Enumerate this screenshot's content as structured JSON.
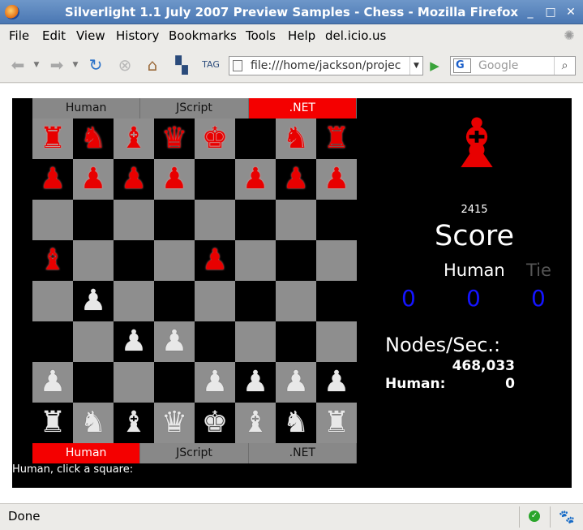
{
  "window": {
    "title": "Silverlight 1.1 July 2007 Preview Samples - Chess - Mozilla Firefox"
  },
  "menu": [
    "File",
    "Edit",
    "View",
    "History",
    "Bookmarks",
    "Tools",
    "Help",
    "del.icio.us"
  ],
  "nav": {
    "url": "file:///home/jackson/projec",
    "search_placeholder": "Google",
    "search_engine": "G"
  },
  "game": {
    "top_tabs": [
      {
        "label": "Human",
        "active": false
      },
      {
        "label": "JScript",
        "active": false
      },
      {
        "label": ".NET",
        "active": true
      }
    ],
    "bottom_tabs": [
      {
        "label": "Human",
        "active": true
      },
      {
        "label": "JScript",
        "active": false
      },
      {
        "label": ".NET",
        "active": false
      }
    ],
    "board": [
      [
        "r:♜",
        "r:♞",
        "r:♝",
        "r:♛",
        "r:♚",
        "",
        "r:♞",
        "r:♜"
      ],
      [
        "r:♟",
        "r:♟",
        "r:♟",
        "r:♟",
        "",
        "r:♟",
        "r:♟",
        "r:♟"
      ],
      [
        "",
        "",
        "",
        "",
        "",
        "",
        "",
        ""
      ],
      [
        "r:♝",
        "",
        "",
        "",
        "r:♟",
        "",
        "",
        ""
      ],
      [
        "",
        "w:♟",
        "",
        "",
        "",
        "",
        "",
        ""
      ],
      [
        "",
        "",
        "w:♟",
        "w:♟",
        "",
        "",
        "",
        ""
      ],
      [
        "w:♟",
        "",
        "",
        "",
        "w:♟",
        "w:♟",
        "w:♟",
        "w:♟"
      ],
      [
        "w:♜",
        "w:♞",
        "w:♝",
        "w:♛",
        "w:♚",
        "w:♝",
        "w:♞",
        "w:♜"
      ]
    ],
    "prompt": "Human, click a square:",
    "year_value": "2415",
    "score_title": "Score",
    "score_headers": [
      {
        "label": "Human",
        "color": "#ffffff"
      },
      {
        "label": "Tie",
        "color": "#555555"
      }
    ],
    "score_values": [
      "0",
      "0",
      "0"
    ],
    "nodes_label": "Nodes/Sec.:",
    "nodes_value": "468,033",
    "human_stat_label": "Human:",
    "human_stat_value": "0",
    "colors": {
      "red": "#e80000",
      "light_square": "#8e8e8e",
      "dark_square": "#000000",
      "score_blue": "#1414ff"
    }
  },
  "status": {
    "text": "Done"
  }
}
